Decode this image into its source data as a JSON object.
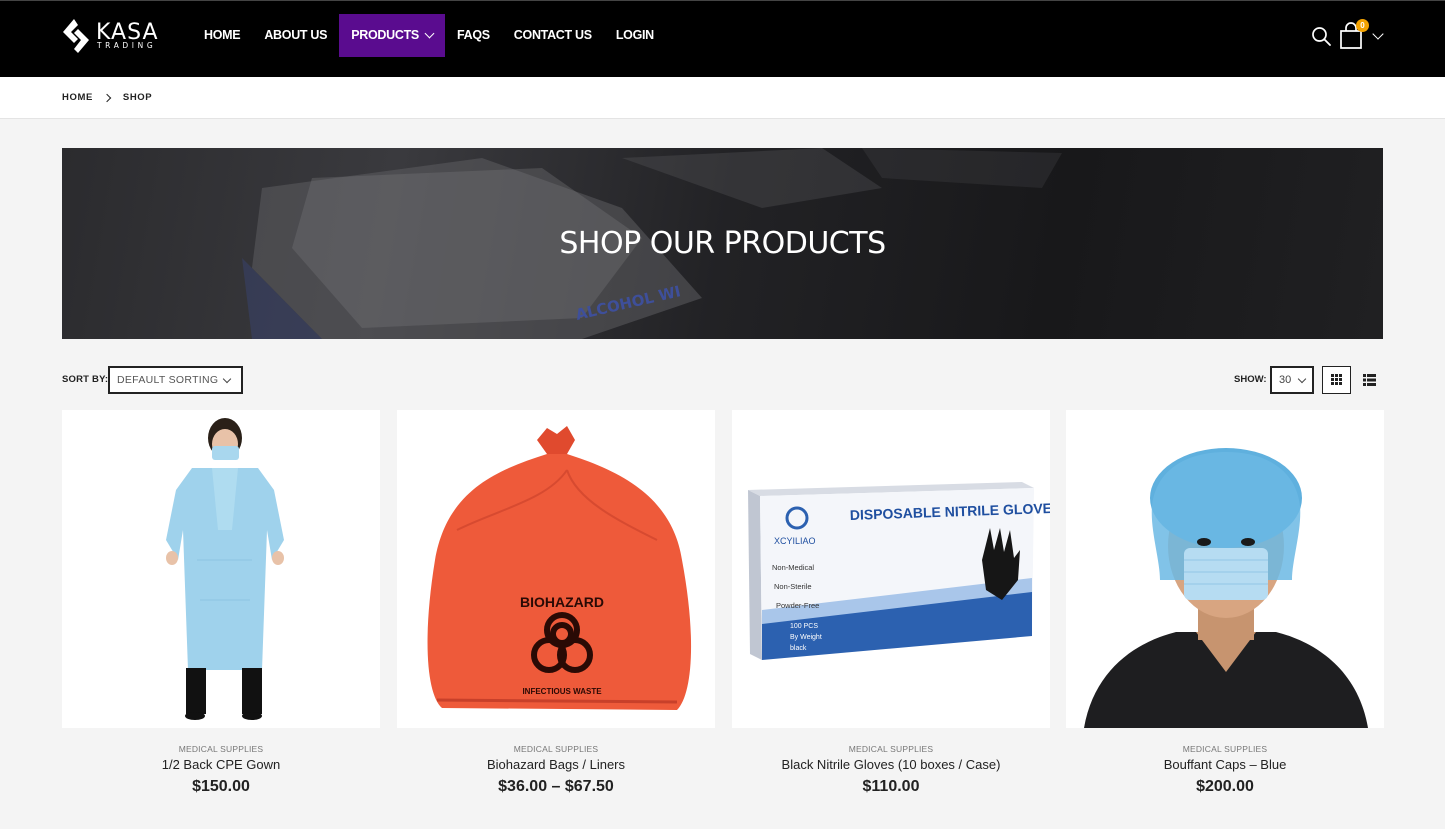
{
  "brand": {
    "name": "KASA",
    "tagline": "TRADING"
  },
  "nav": {
    "items": [
      {
        "label": "HOME"
      },
      {
        "label": "ABOUT US"
      },
      {
        "label": "PRODUCTS",
        "active": true
      },
      {
        "label": "FAQS"
      },
      {
        "label": "CONTACT US"
      },
      {
        "label": "LOGIN"
      }
    ],
    "cart_count": "0"
  },
  "breadcrumb": {
    "home": "HOME",
    "current": "SHOP"
  },
  "banner": {
    "title": "SHOP OUR PRODUCTS",
    "image_text": "ALCOHOL WI"
  },
  "toolbar": {
    "sort_label": "SORT BY:",
    "sort_value": "DEFAULT SORTING",
    "show_label": "SHOW:",
    "show_value": "30"
  },
  "products": [
    {
      "category": "MEDICAL SUPPLIES",
      "name": "1/2 Back CPE Gown",
      "price": "$150.00"
    },
    {
      "category": "MEDICAL SUPPLIES",
      "name": "Biohazard Bags / Liners",
      "price": "$36.00 – $67.50",
      "image_text": "BIOHAZARD",
      "image_subtext": "INFECTIOUS WASTE"
    },
    {
      "category": "MEDICAL SUPPLIES",
      "name": "Black Nitrile Gloves (10 boxes / Case)",
      "price": "$110.00",
      "image_text": "DISPOSABLE NITRILE GLOVES",
      "image_brand": "XCYILIAO",
      "image_lines": [
        "Non-Medical",
        "Non-Sterile",
        "Powder-Free"
      ],
      "image_pcs": "100 PCS",
      "image_weight": "By Weight",
      "image_color": "black"
    },
    {
      "category": "MEDICAL SUPPLIES",
      "name": "Bouffant Caps – Blue",
      "price": "$200.00"
    }
  ],
  "colors": {
    "accent": "#5a0c8f",
    "badge": "#f4a300",
    "header": "#000000"
  }
}
